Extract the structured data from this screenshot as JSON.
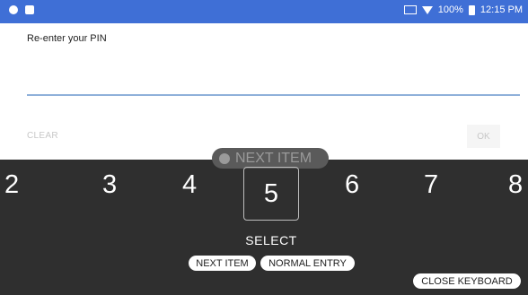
{
  "status_bar": {
    "battery": "100%",
    "time": "12:15 PM"
  },
  "dialog": {
    "prompt": "Re-enter your PIN",
    "pin_value": "",
    "clear_label": "CLEAR",
    "ok_label": "OK"
  },
  "keyboard": {
    "hint_label": "NEXT ITEM",
    "digits": [
      "2",
      "3",
      "4",
      "5",
      "6",
      "7",
      "8"
    ],
    "selected_digit": "5",
    "select_label": "SELECT",
    "next_item_label": "NEXT ITEM",
    "normal_entry_label": "NORMAL ENTRY",
    "close_label": "CLOSE KEYBOARD"
  }
}
